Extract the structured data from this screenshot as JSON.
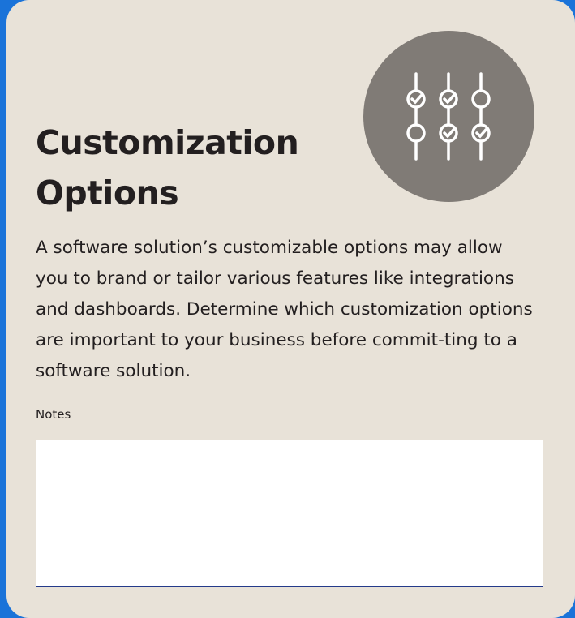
{
  "card": {
    "title": "Customization Options",
    "description": "A software solution’s customizable options may allow you to brand or tailor various features like integrations and dashboards. Determine which customization options are important to your business before commit-ting to a software solution.",
    "icon": "sliders-check-icon"
  },
  "notes": {
    "label": "Notes",
    "value": ""
  },
  "colors": {
    "background": "#1a73d9",
    "card": "#e8e2d8",
    "icon_circle": "#807b76",
    "text": "#231f20",
    "notes_border": "#243a8a"
  }
}
